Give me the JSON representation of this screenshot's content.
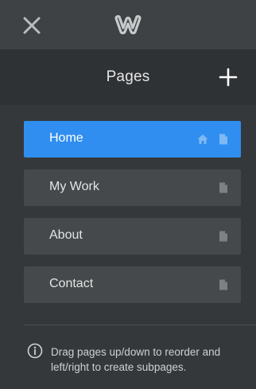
{
  "header": {
    "title": "Pages"
  },
  "pages": [
    {
      "label": "Home",
      "is_home": true,
      "active": true
    },
    {
      "label": "My Work",
      "is_home": false,
      "active": false
    },
    {
      "label": "About",
      "is_home": false,
      "active": false
    },
    {
      "label": "Contact",
      "is_home": false,
      "active": false
    }
  ],
  "footer": {
    "hint": "Drag pages up/down to reorder and left/right to create subpages."
  },
  "icons": {
    "close": "close-icon",
    "logo": "weebly-logo",
    "add": "plus-icon",
    "home": "home-icon",
    "page": "page-icon",
    "info": "info-icon"
  },
  "colors": {
    "accent": "#2f8ef0",
    "panel": "#34383b",
    "topbar": "#3e4245",
    "header": "#2f3234",
    "item": "#45494c"
  }
}
